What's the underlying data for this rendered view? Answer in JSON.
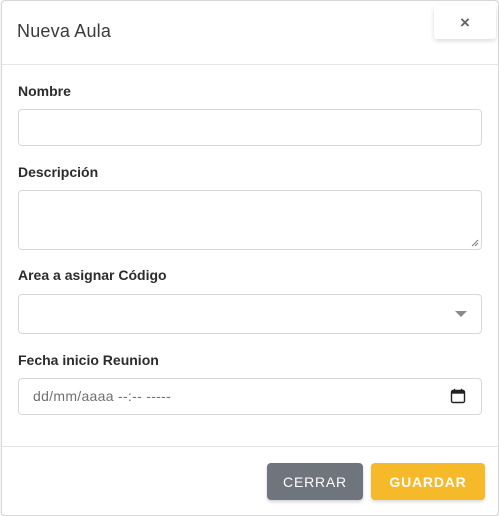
{
  "modal": {
    "title": "Nueva Aula",
    "close_label": "×"
  },
  "form": {
    "nombre": {
      "label": "Nombre",
      "value": ""
    },
    "descripcion": {
      "label": "Descripción",
      "value": ""
    },
    "area": {
      "label": "Area a asignar Código",
      "selected": ""
    },
    "fecha": {
      "label": "Fecha inicio Reunion",
      "placeholder": "dd/mm/aaaa --:-- -----"
    }
  },
  "footer": {
    "cerrar_label": "CERRAR",
    "guardar_label": "GUARDAR"
  },
  "colors": {
    "cerrar_bg": "#6e757c",
    "guardar_bg": "#f5b929"
  },
  "icons": {
    "close": "close-icon",
    "dropdown": "chevron-down-icon",
    "calendar": "calendar-icon"
  }
}
